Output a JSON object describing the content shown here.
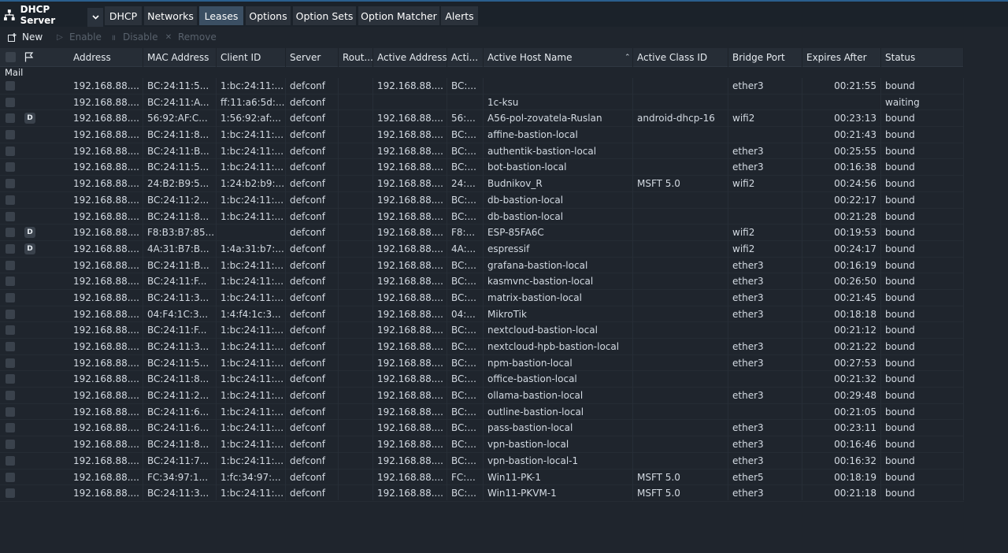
{
  "app": {
    "title": "DHCP Server",
    "icon": "network-tree-icon"
  },
  "tabs": [
    {
      "label": "DHCP",
      "active": false
    },
    {
      "label": "Networks",
      "active": false
    },
    {
      "label": "Leases",
      "active": true
    },
    {
      "label": "Options",
      "active": false
    },
    {
      "label": "Option Sets",
      "active": false
    },
    {
      "label": "Option Matcher",
      "active": false
    },
    {
      "label": "Alerts",
      "active": false
    }
  ],
  "toolbar": {
    "new_label": "New",
    "enable_label": "Enable",
    "disable_label": "Disable",
    "remove_label": "Remove"
  },
  "table": {
    "columns": [
      "Address",
      "MAC Address",
      "Client ID",
      "Server",
      "Rout...",
      "Active Address",
      "Acti...",
      "Active Host Name",
      "Active Class ID",
      "Bridge Port",
      "Expires After",
      "Status"
    ],
    "sorted_column": "Active Host Name",
    "group_label": "Mail",
    "rows": [
      {
        "flag": "",
        "address": "192.168.88....",
        "mac": "BC:24:11:5...",
        "client_id": "1:bc:24:11:...",
        "server": "defconf",
        "route": "",
        "active_address": "192.168.88....",
        "active_mac": "BC:...",
        "host": "",
        "class_id": "",
        "bridge": "ether3",
        "expires": "00:21:55",
        "status": "bound"
      },
      {
        "flag": "",
        "address": "192.168.88....",
        "mac": "BC:24:11:A...",
        "client_id": "ff:11:a6:5d:...",
        "server": "defconf",
        "route": "",
        "active_address": "",
        "active_mac": "",
        "host": "1c-ksu",
        "class_id": "",
        "bridge": "",
        "expires": "",
        "status": "waiting"
      },
      {
        "flag": "D",
        "address": "192.168.88....",
        "mac": "56:92:AF:C...",
        "client_id": "1:56:92:af:...",
        "server": "defconf",
        "route": "",
        "active_address": "192.168.88....",
        "active_mac": "56:...",
        "host": "A56-pol-zovatela-Ruslan",
        "class_id": "android-dhcp-16",
        "bridge": "wifi2",
        "expires": "00:23:13",
        "status": "bound"
      },
      {
        "flag": "",
        "address": "192.168.88....",
        "mac": "BC:24:11:8...",
        "client_id": "1:bc:24:11:...",
        "server": "defconf",
        "route": "",
        "active_address": "192.168.88....",
        "active_mac": "BC:...",
        "host": "affine-bastion-local",
        "class_id": "",
        "bridge": "",
        "expires": "00:21:43",
        "status": "bound"
      },
      {
        "flag": "",
        "address": "192.168.88....",
        "mac": "BC:24:11:B...",
        "client_id": "1:bc:24:11:...",
        "server": "defconf",
        "route": "",
        "active_address": "192.168.88....",
        "active_mac": "BC:...",
        "host": "authentik-bastion-local",
        "class_id": "",
        "bridge": "ether3",
        "expires": "00:25:55",
        "status": "bound"
      },
      {
        "flag": "",
        "address": "192.168.88....",
        "mac": "BC:24:11:5...",
        "client_id": "1:bc:24:11:...",
        "server": "defconf",
        "route": "",
        "active_address": "192.168.88....",
        "active_mac": "BC:...",
        "host": "bot-bastion-local",
        "class_id": "",
        "bridge": "ether3",
        "expires": "00:16:38",
        "status": "bound"
      },
      {
        "flag": "",
        "address": "192.168.88....",
        "mac": "24:B2:B9:5...",
        "client_id": "1:24:b2:b9:...",
        "server": "defconf",
        "route": "",
        "active_address": "192.168.88....",
        "active_mac": "24:...",
        "host": "Budnikov_R",
        "class_id": "MSFT 5.0",
        "bridge": "wifi2",
        "expires": "00:24:56",
        "status": "bound"
      },
      {
        "flag": "",
        "address": "192.168.88....",
        "mac": "BC:24:11:2...",
        "client_id": "1:bc:24:11:...",
        "server": "defconf",
        "route": "",
        "active_address": "192.168.88....",
        "active_mac": "BC:...",
        "host": "db-bastion-local",
        "class_id": "",
        "bridge": "",
        "expires": "00:22:17",
        "status": "bound"
      },
      {
        "flag": "",
        "address": "192.168.88....",
        "mac": "BC:24:11:8...",
        "client_id": "1:bc:24:11:...",
        "server": "defconf",
        "route": "",
        "active_address": "192.168.88....",
        "active_mac": "BC:...",
        "host": "db-bastion-local",
        "class_id": "",
        "bridge": "",
        "expires": "00:21:28",
        "status": "bound"
      },
      {
        "flag": "D",
        "address": "192.168.88....",
        "mac": "F8:B3:B7:85...",
        "client_id": "",
        "server": "defconf",
        "route": "",
        "active_address": "192.168.88....",
        "active_mac": "F8:...",
        "host": "ESP-85FA6C",
        "class_id": "",
        "bridge": "wifi2",
        "expires": "00:19:53",
        "status": "bound"
      },
      {
        "flag": "D",
        "address": "192.168.88....",
        "mac": "4A:31:B7:B...",
        "client_id": "1:4a:31:b7:...",
        "server": "defconf",
        "route": "",
        "active_address": "192.168.88....",
        "active_mac": "4A:...",
        "host": "espressif",
        "class_id": "",
        "bridge": "wifi2",
        "expires": "00:24:17",
        "status": "bound"
      },
      {
        "flag": "",
        "address": "192.168.88....",
        "mac": "BC:24:11:B...",
        "client_id": "1:bc:24:11:...",
        "server": "defconf",
        "route": "",
        "active_address": "192.168.88....",
        "active_mac": "BC:...",
        "host": "grafana-bastion-local",
        "class_id": "",
        "bridge": "ether3",
        "expires": "00:16:19",
        "status": "bound"
      },
      {
        "flag": "",
        "address": "192.168.88....",
        "mac": "BC:24:11:F...",
        "client_id": "1:bc:24:11:...",
        "server": "defconf",
        "route": "",
        "active_address": "192.168.88....",
        "active_mac": "BC:...",
        "host": "kasmvnc-bastion-local",
        "class_id": "",
        "bridge": "ether3",
        "expires": "00:26:50",
        "status": "bound"
      },
      {
        "flag": "",
        "address": "192.168.88....",
        "mac": "BC:24:11:3...",
        "client_id": "1:bc:24:11:...",
        "server": "defconf",
        "route": "",
        "active_address": "192.168.88....",
        "active_mac": "BC:...",
        "host": "matrix-bastion-local",
        "class_id": "",
        "bridge": "ether3",
        "expires": "00:21:45",
        "status": "bound"
      },
      {
        "flag": "",
        "address": "192.168.88....",
        "mac": "04:F4:1C:3...",
        "client_id": "1:4:f4:1c:3...",
        "server": "defconf",
        "route": "",
        "active_address": "192.168.88....",
        "active_mac": "04:...",
        "host": "MikroTik",
        "class_id": "",
        "bridge": "ether3",
        "expires": "00:18:18",
        "status": "bound"
      },
      {
        "flag": "",
        "address": "192.168.88....",
        "mac": "BC:24:11:F...",
        "client_id": "1:bc:24:11:...",
        "server": "defconf",
        "route": "",
        "active_address": "192.168.88....",
        "active_mac": "BC:...",
        "host": "nextcloud-bastion-local",
        "class_id": "",
        "bridge": "",
        "expires": "00:21:12",
        "status": "bound"
      },
      {
        "flag": "",
        "address": "192.168.88....",
        "mac": "BC:24:11:3...",
        "client_id": "1:bc:24:11:...",
        "server": "defconf",
        "route": "",
        "active_address": "192.168.88....",
        "active_mac": "BC:...",
        "host": "nextcloud-hpb-bastion-local",
        "class_id": "",
        "bridge": "ether3",
        "expires": "00:21:22",
        "status": "bound"
      },
      {
        "flag": "",
        "address": "192.168.88....",
        "mac": "BC:24:11:5...",
        "client_id": "1:bc:24:11:...",
        "server": "defconf",
        "route": "",
        "active_address": "192.168.88....",
        "active_mac": "BC:...",
        "host": "npm-bastion-local",
        "class_id": "",
        "bridge": "ether3",
        "expires": "00:27:53",
        "status": "bound"
      },
      {
        "flag": "",
        "address": "192.168.88....",
        "mac": "BC:24:11:8...",
        "client_id": "1:bc:24:11:...",
        "server": "defconf",
        "route": "",
        "active_address": "192.168.88....",
        "active_mac": "BC:...",
        "host": "office-bastion-local",
        "class_id": "",
        "bridge": "",
        "expires": "00:21:32",
        "status": "bound"
      },
      {
        "flag": "",
        "address": "192.168.88....",
        "mac": "BC:24:11:2...",
        "client_id": "1:bc:24:11:...",
        "server": "defconf",
        "route": "",
        "active_address": "192.168.88....",
        "active_mac": "BC:...",
        "host": "ollama-bastion-local",
        "class_id": "",
        "bridge": "ether3",
        "expires": "00:29:48",
        "status": "bound"
      },
      {
        "flag": "",
        "address": "192.168.88....",
        "mac": "BC:24:11:6...",
        "client_id": "1:bc:24:11:...",
        "server": "defconf",
        "route": "",
        "active_address": "192.168.88....",
        "active_mac": "BC:...",
        "host": "outline-bastion-local",
        "class_id": "",
        "bridge": "",
        "expires": "00:21:05",
        "status": "bound"
      },
      {
        "flag": "",
        "address": "192.168.88....",
        "mac": "BC:24:11:6...",
        "client_id": "1:bc:24:11:...",
        "server": "defconf",
        "route": "",
        "active_address": "192.168.88....",
        "active_mac": "BC:...",
        "host": "pass-bastion-local",
        "class_id": "",
        "bridge": "ether3",
        "expires": "00:23:11",
        "status": "bound"
      },
      {
        "flag": "",
        "address": "192.168.88....",
        "mac": "BC:24:11:8...",
        "client_id": "1:bc:24:11:...",
        "server": "defconf",
        "route": "",
        "active_address": "192.168.88....",
        "active_mac": "BC:...",
        "host": "vpn-bastion-local",
        "class_id": "",
        "bridge": "ether3",
        "expires": "00:16:46",
        "status": "bound"
      },
      {
        "flag": "",
        "address": "192.168.88....",
        "mac": "BC:24:11:7...",
        "client_id": "1:bc:24:11:...",
        "server": "defconf",
        "route": "",
        "active_address": "192.168.88....",
        "active_mac": "BC:...",
        "host": "vpn-bastion-local-1",
        "class_id": "",
        "bridge": "ether3",
        "expires": "00:16:32",
        "status": "bound"
      },
      {
        "flag": "",
        "address": "192.168.88....",
        "mac": "FC:34:97:1...",
        "client_id": "1:fc:34:97:...",
        "server": "defconf",
        "route": "",
        "active_address": "192.168.88....",
        "active_mac": "FC:...",
        "host": "Win11-PK-1",
        "class_id": "MSFT 5.0",
        "bridge": "ether5",
        "expires": "00:18:19",
        "status": "bound"
      },
      {
        "flag": "",
        "address": "192.168.88....",
        "mac": "BC:24:11:3...",
        "client_id": "1:bc:24:11:...",
        "server": "defconf",
        "route": "",
        "active_address": "192.168.88....",
        "active_mac": "BC:...",
        "host": "Win11-PKVM-1",
        "class_id": "MSFT 5.0",
        "bridge": "ether3",
        "expires": "00:21:18",
        "status": "bound"
      }
    ]
  },
  "colors": {
    "background": "#1f252d",
    "active_tab": "#3b4f63",
    "tab": "#2b323b",
    "top_accent": "#2a5f8e",
    "text": "#d3dae2"
  }
}
